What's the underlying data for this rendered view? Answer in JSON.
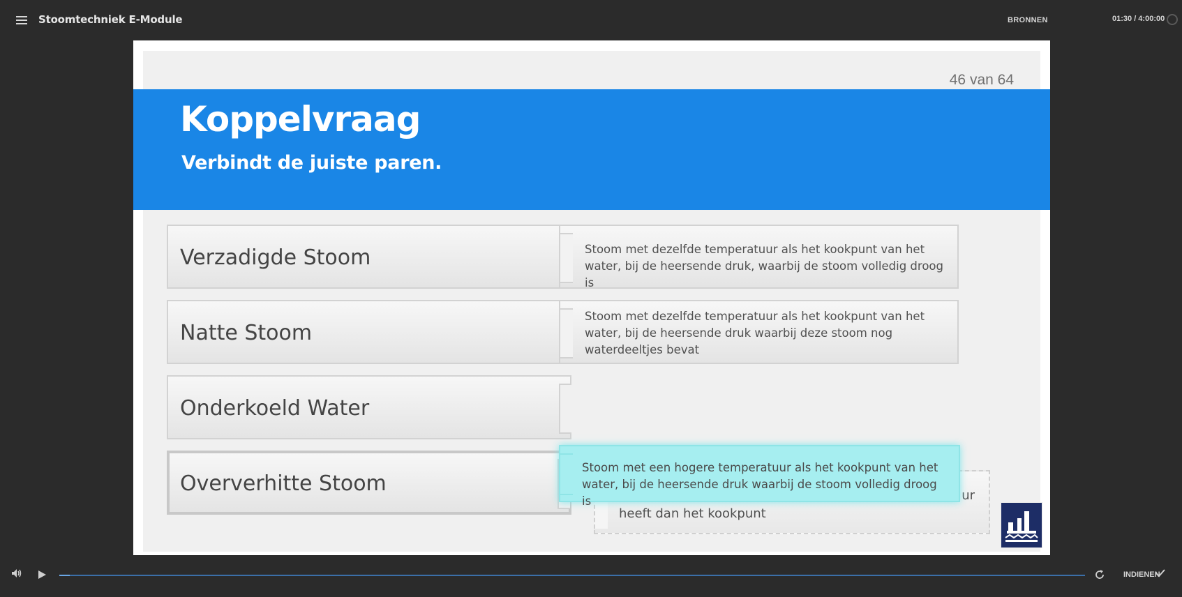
{
  "topbar": {
    "title": "Stoomtechniek E-Module",
    "menu_icon": "hamburger-icon",
    "resources_label": "BRONNEN",
    "timer": "01:30 / 4:00:00"
  },
  "slide": {
    "counter": "46 van 64",
    "title": "Koppelvraag",
    "subtitle": "Verbindt de juiste paren.",
    "terms": [
      {
        "label": "Verzadigde Stoom"
      },
      {
        "label": "Natte Stoom"
      },
      {
        "label": "Onderkoeld Water"
      },
      {
        "label": "Oververhitte Stoom"
      }
    ],
    "definitions": [
      {
        "text": "Stoom met dezelfde temperatuur als het kookpunt van het water, bij de heersende druk, waarbij de stoom volledig droog is"
      },
      {
        "text": "Stoom met dezelfde temperatuur als het kookpunt van het water, bij de heersende druk waarbij deze stoom nog waterdeeltjes bevat"
      }
    ],
    "dragging_definition": "Stoom met een hogere temperatuur als het kookpunt van het water, bij de heersende druk waarbij de stoom volledig droog is",
    "partial_definition": {
      "line1_end": "ur",
      "line2": "heeft dan het kookpunt"
    }
  },
  "bottombar": {
    "volume_icon": "volume-icon",
    "play_icon": "play-icon",
    "progress": 0.01,
    "reload_icon": "reload-icon",
    "submit_label": "INDIENEN",
    "check_icon": "check-icon"
  },
  "colors": {
    "banner": "#1a86e6",
    "drag_tile": "#a6eef0",
    "background": "#2b2b2b"
  }
}
